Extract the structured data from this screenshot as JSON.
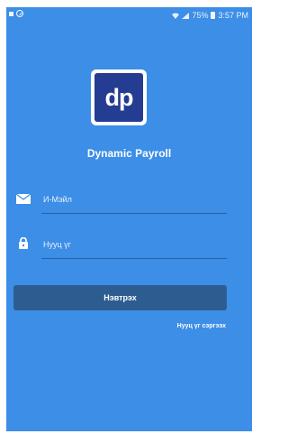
{
  "status_bar": {
    "battery": "75%",
    "time": "3:57 PM"
  },
  "logo": {
    "text": "dp"
  },
  "app": {
    "title": "Dynamic Payroll"
  },
  "form": {
    "email_placeholder": "И-Мэйл",
    "password_placeholder": "Нууц үг",
    "login_label": "Нэвтрэх",
    "forgot_password_label": "Нууц үг сэргээх"
  },
  "colors": {
    "background": "#3c8ee6",
    "logo_background": "#243c91",
    "button": "#2d5d90"
  },
  "icons": {
    "email": "envelope-icon",
    "password": "lock-icon",
    "wifi": "wifi-icon",
    "signal": "signal-icon",
    "battery": "battery-icon",
    "notification": "notification-icon",
    "do_not_disturb": "do-not-disturb-icon"
  }
}
